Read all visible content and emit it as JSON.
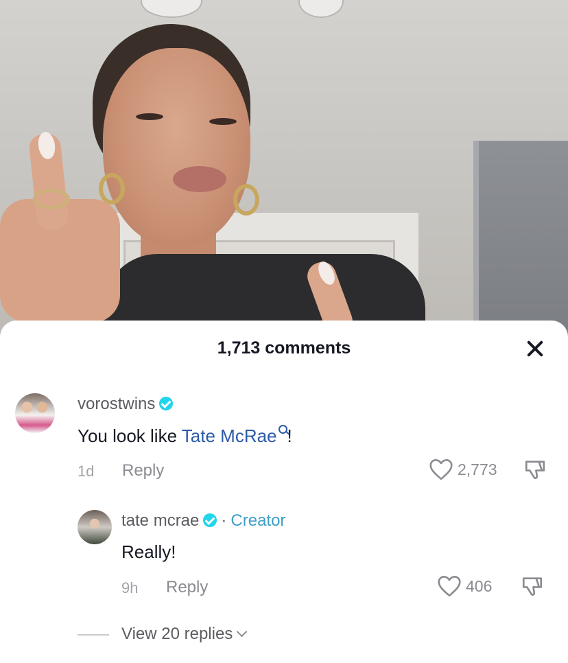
{
  "sheet": {
    "comment_count": "1,713 comments",
    "close_icon": "close-icon"
  },
  "comments": [
    {
      "username": "vorostwins",
      "verified": true,
      "text_before": "You look like ",
      "mention": "Tate McRae",
      "text_after": "!",
      "time": "1d",
      "reply_label": "Reply",
      "likes": "2,773"
    },
    {
      "username": "tate mcrae",
      "verified": true,
      "separator": "·",
      "badge": "Creator",
      "text": "Really!",
      "time": "9h",
      "reply_label": "Reply",
      "likes": "406"
    }
  ],
  "view_replies": "View 20 replies",
  "icons": {
    "heart": "heart-outline-icon",
    "dislike": "thumbs-down-icon",
    "verified": "verified-badge-icon",
    "mention_search": "search-icon"
  },
  "colors": {
    "verified": "#20d5ec",
    "creator": "#3e9ec7",
    "mention": "#2b5aa8",
    "primary_text": "#161823",
    "secondary_text": "#8a8b91"
  }
}
